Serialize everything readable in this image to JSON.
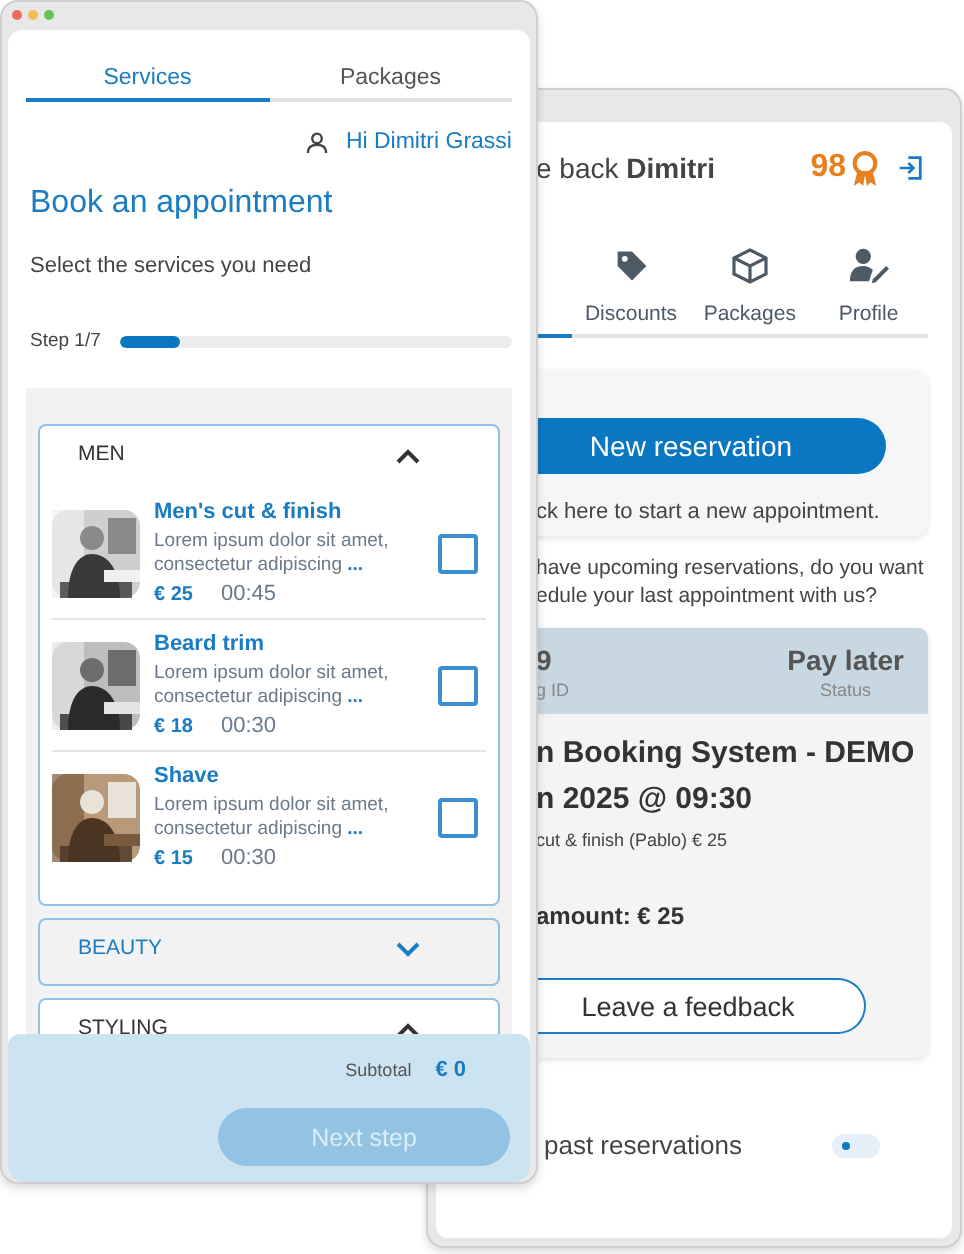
{
  "booking": {
    "tabs": [
      {
        "label": "Services",
        "selected": true
      },
      {
        "label": "Packages",
        "selected": false
      }
    ],
    "user": "Hi Dimitri Grassi",
    "title": "Book an appointment",
    "subtitle": "Select the services you need",
    "step": {
      "label": "Step 1/7",
      "level": 0.15
    },
    "categories": [
      {
        "name": "MEN",
        "expanded": true,
        "services": [
          {
            "name": "Men's cut & finish",
            "description": "Lorem ipsum dolor sit amet, consectetur adipiscing",
            "more": "...",
            "price": "€ 25",
            "duration": "00:45",
            "checked": false
          },
          {
            "name": "Beard trim",
            "description": "Lorem ipsum dolor sit amet, consectetur adipiscing",
            "more": "...",
            "price": "€ 18",
            "duration": "00:30",
            "checked": false
          },
          {
            "name": "Shave",
            "description": "Lorem ipsum dolor sit amet, consectetur adipiscing",
            "more": "...",
            "price": "€ 15",
            "duration": "00:30",
            "checked": false
          }
        ]
      },
      {
        "name": "BEAUTY",
        "expanded": false
      },
      {
        "name": "STYLING",
        "expanded": true
      }
    ],
    "subtotal_label": "Subtotal",
    "subtotal": "€ 0",
    "next_button": {
      "label": "Next step",
      "disabled": true
    }
  },
  "dashboard": {
    "greeting": "e back **Dimitri**",
    "points": "98",
    "tabs": [
      {
        "label": "Discounts",
        "selected": false,
        "kind": "tag"
      },
      {
        "label": "Packages",
        "selected": false,
        "kind": "box"
      },
      {
        "label": "Profile",
        "selected": false,
        "kind": "user-edit"
      }
    ],
    "new_reservation": {
      "button": "New reservation",
      "hint": "ck here to start a new appointment."
    },
    "message": "have upcoming reservations, do you want\nedule your last appointment with us?",
    "reservation": {
      "id": "9",
      "id_label": "g ID",
      "status": "Pay later",
      "status_label": "Status",
      "title": "n Booking System - DEMO",
      "date": "n 2025 @ 09:30",
      "service": "cut & finish (Pablo) € 25",
      "total": "amount: € 25",
      "feedback_button": "Leave a feedback"
    },
    "past": {
      "label": "past reservations",
      "on": false
    }
  }
}
